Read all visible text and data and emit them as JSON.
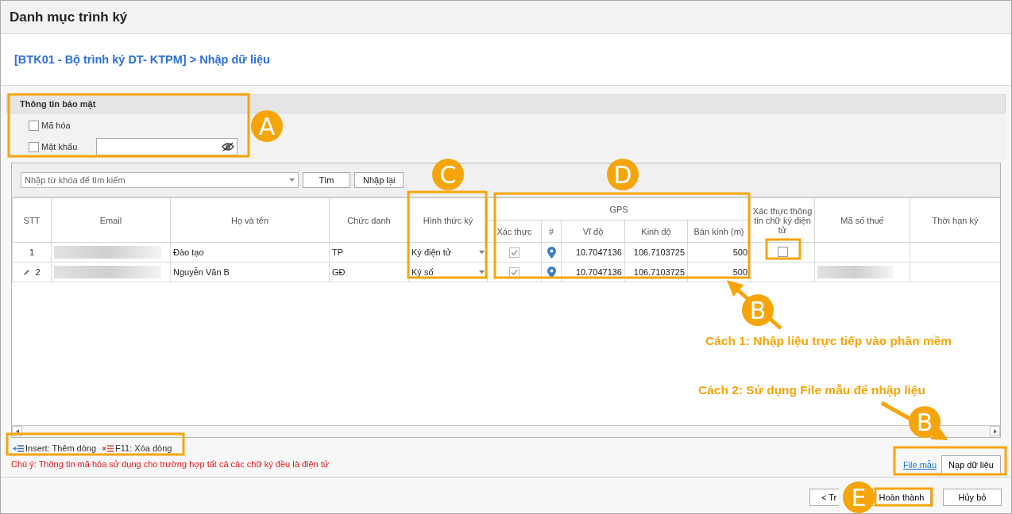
{
  "window": {
    "title": "Danh mục trình ký"
  },
  "breadcrumb": "[BTK01 - Bộ trình ký DT- KTPM] > Nhập dữ liệu",
  "security": {
    "title": "Thông tin bảo mật",
    "options": [
      {
        "kind": "checkbox",
        "label": "Mã hóa",
        "checked": false
      },
      {
        "kind": "password",
        "label": "Mật khẩu",
        "checked": false
      }
    ]
  },
  "search": {
    "placeholder": "Nhập từ khóa để tìm kiếm",
    "buttons": [
      "Tìm",
      "Nhập lại"
    ]
  },
  "table": {
    "columns": [
      {
        "label": "STT"
      },
      {
        "label": "Email"
      },
      {
        "label": "Họ và tên"
      },
      {
        "label": "Chức danh"
      },
      {
        "label": "Hình thức ký"
      },
      {
        "label": "GPS",
        "children": [
          {
            "label": "Xác thực"
          },
          {
            "label": "#"
          },
          {
            "label": "Vĩ độ"
          },
          {
            "label": "Kinh độ"
          },
          {
            "label": "Bán kính (m)"
          }
        ]
      },
      {
        "label": "Xác thực thông tin chữ ký điện tử"
      },
      {
        "label": "Mã số thuế"
      },
      {
        "label": "Thời hạn ký"
      }
    ],
    "rows": [
      {
        "stt": "1",
        "editing": false,
        "email_redacted": true,
        "name": "Đào tạo",
        "position": "TP",
        "sign_method": "Ký điện tử",
        "gps_verified": true,
        "lat": "10.7047136",
        "lng": "106.7103725",
        "radius": "500",
        "e_sign_check": {
          "checked": false
        },
        "tax_id_redacted": false
      },
      {
        "stt": "2",
        "editing": true,
        "email_redacted": true,
        "name": "Nguyễn Văn B",
        "position": "GĐ",
        "sign_method": "Ký số",
        "gps_verified": true,
        "lat": "10.7047136",
        "lng": "106.7103725",
        "radius": "500",
        "tax_id_redacted": true
      }
    ]
  },
  "shortcuts": [
    {
      "kind": "insert",
      "label": "Insert: Thêm dòng"
    },
    {
      "kind": "delete",
      "label": "F11: Xóa dòng"
    }
  ],
  "note": "Chú ý: Thông tin mã hóa sử dụng cho trường hợp tất cả các chữ ký đều là điện tử",
  "file_link": "File mẫu",
  "load_button": "Nạp dữ liệu",
  "footer_buttons": [
    "< Tr",
    "Hoàn thành",
    "Hủy bỏ"
  ],
  "annotations": {
    "markers": [
      "A",
      "C",
      "D",
      "B",
      "B",
      "E"
    ],
    "captions": [
      "Cách 1: Nhập liệu trực tiếp vào phần mềm",
      "Cách 2: Sử dụng File mẫu để nhập liệu"
    ]
  }
}
